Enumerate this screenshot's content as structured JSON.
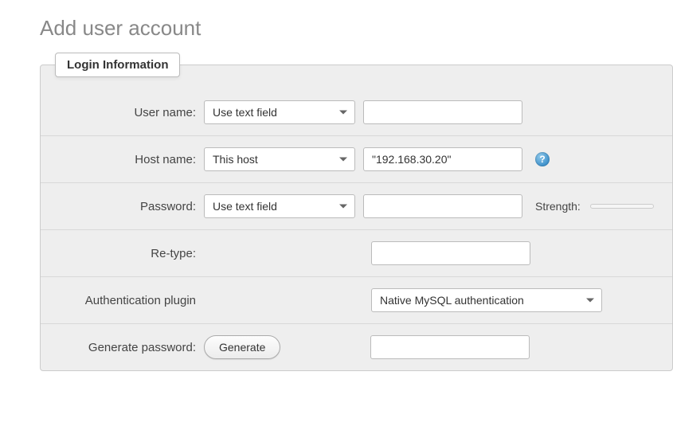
{
  "page": {
    "title": "Add user account"
  },
  "fieldset": {
    "legend": "Login Information"
  },
  "labels": {
    "username": "User name:",
    "hostname": "Host name:",
    "password": "Password:",
    "retype": "Re-type:",
    "auth_plugin": "Authentication plugin",
    "generate_password": "Generate password:",
    "strength": "Strength:"
  },
  "selects": {
    "username_mode": "Use text field",
    "hostname_mode": "This host",
    "password_mode": "Use text field",
    "auth_plugin": "Native MySQL authentication"
  },
  "inputs": {
    "username": "",
    "hostname": "\"192.168.30.20\"",
    "password": "",
    "retype": "",
    "generated": ""
  },
  "buttons": {
    "generate": "Generate"
  }
}
